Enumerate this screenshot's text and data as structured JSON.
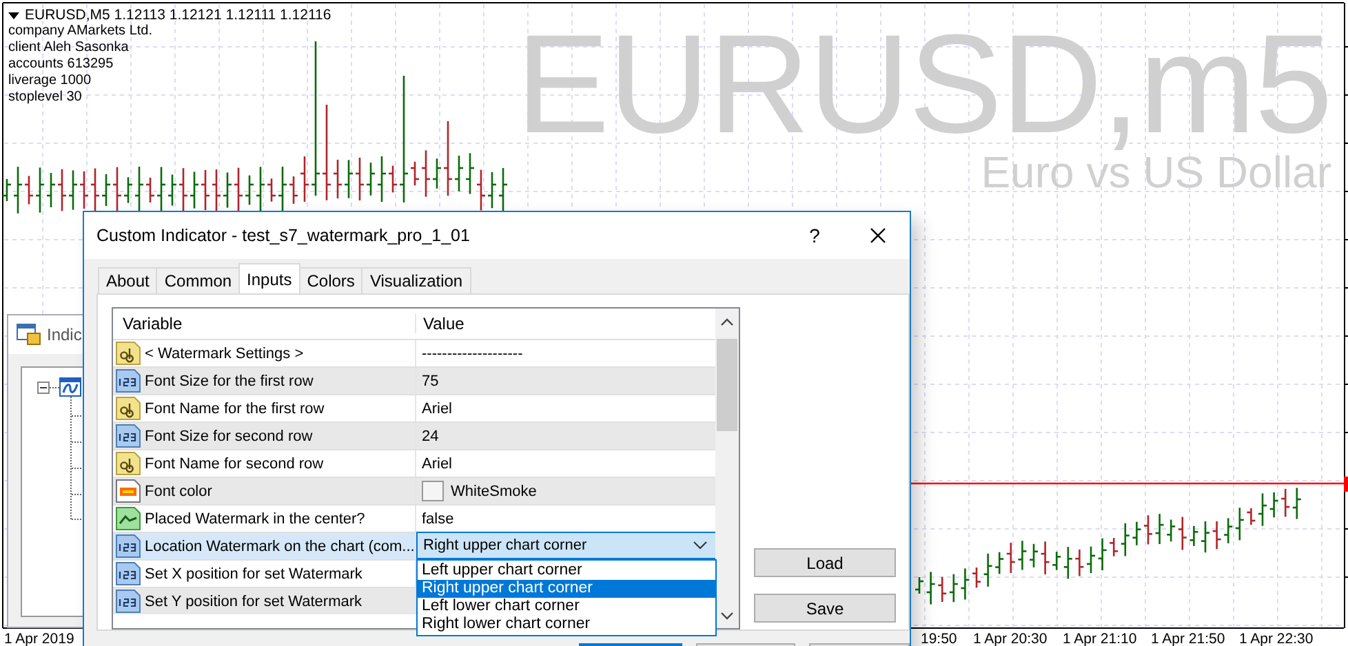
{
  "chart": {
    "symbol_line": "EURUSD,M5  1.12113 1.12121 1.12111 1.12116",
    "info_lines": [
      "company AMarkets Ltd.",
      "client Aleh Sasonka",
      "accounts 613295",
      "liverage 1000",
      "stoplevel 30"
    ],
    "watermark": {
      "title": "EURUSD,m5",
      "subtitle": "Euro vs US Dollar"
    },
    "time_labels": [
      "1 Apr 2019",
      "19:50",
      "1 Apr 20:30",
      "1 Apr 21:10",
      "1 Apr 21:50",
      "1 Apr 22:30"
    ]
  },
  "indicators_window": {
    "title": "Indic"
  },
  "dialog": {
    "title": "Custom Indicator - test_s7_watermark_pro_1_01",
    "help": "?",
    "tabs": [
      {
        "label": "About",
        "selected": false
      },
      {
        "label": "Common",
        "selected": false
      },
      {
        "label": "Inputs",
        "selected": true
      },
      {
        "label": "Colors",
        "selected": false
      },
      {
        "label": "Visualization",
        "selected": false
      }
    ],
    "table": {
      "columns": [
        "Variable",
        "Value"
      ],
      "rows": [
        {
          "kind": "string",
          "variable": "< Watermark Settings >",
          "value": "--------------------",
          "selected": false
        },
        {
          "kind": "int",
          "variable": "Font Size for the first row",
          "value": "75",
          "selected": false
        },
        {
          "kind": "string",
          "variable": "Font Name for the first row",
          "value": "Ariel",
          "selected": false
        },
        {
          "kind": "int",
          "variable": "Font Size for second row",
          "value": "24",
          "selected": false
        },
        {
          "kind": "string",
          "variable": "Font Name for second row",
          "value": "Ariel",
          "selected": false
        },
        {
          "kind": "color",
          "variable": "Font color",
          "value": "WhiteSmoke",
          "selected": false
        },
        {
          "kind": "bool",
          "variable": "Placed Watermark in the center?",
          "value": "false",
          "selected": false
        },
        {
          "kind": "int",
          "variable": "Location Watermark on the chart (com...",
          "selected": true
        },
        {
          "kind": "int",
          "variable": "Set X position for set Watermark",
          "selected": false
        },
        {
          "kind": "int",
          "variable": "Set Y position for set Watermark",
          "selected": false
        }
      ],
      "dropdown": {
        "value": "Right upper chart corner",
        "options": [
          {
            "label": "Left upper chart corner",
            "selected": false
          },
          {
            "label": "Right upper chart corner",
            "selected": true
          },
          {
            "label": "Left lower chart corner",
            "selected": false
          },
          {
            "label": "Right lower chart corner",
            "selected": false
          }
        ]
      }
    },
    "buttons": [
      "Load",
      "Save"
    ]
  }
}
